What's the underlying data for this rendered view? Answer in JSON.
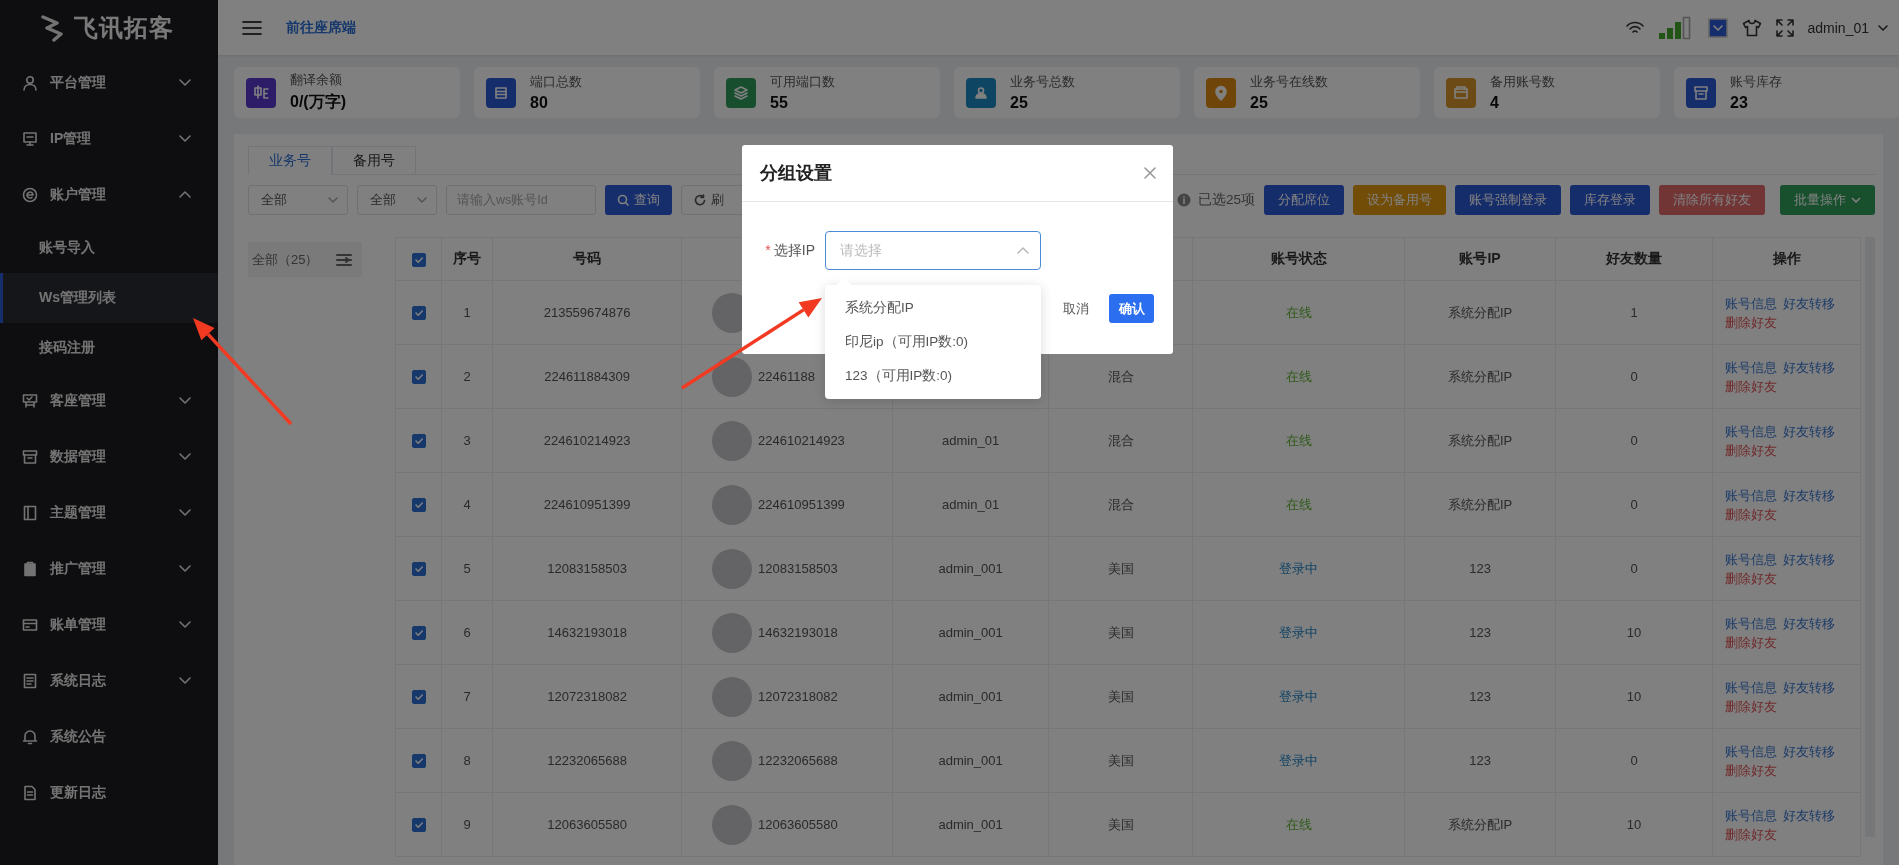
{
  "sidebar": {
    "logo": "飞讯拓客",
    "items": [
      {
        "label": "平台管理",
        "kind": "group",
        "expanded": false
      },
      {
        "label": "IP管理",
        "kind": "group",
        "expanded": false
      },
      {
        "label": "账户管理",
        "kind": "group",
        "expanded": true,
        "children": [
          {
            "label": "账号导入",
            "selected": false
          },
          {
            "label": "Ws管理列表",
            "selected": true
          },
          {
            "label": "接码注册",
            "selected": false
          }
        ]
      },
      {
        "label": "客座管理",
        "kind": "group",
        "expanded": false
      },
      {
        "label": "数据管理",
        "kind": "group",
        "expanded": false
      },
      {
        "label": "主题管理",
        "kind": "group",
        "expanded": false
      },
      {
        "label": "推广管理",
        "kind": "group",
        "expanded": false
      },
      {
        "label": "账单管理",
        "kind": "group",
        "expanded": false
      },
      {
        "label": "系统日志",
        "kind": "group",
        "expanded": false
      },
      {
        "label": "系统公告",
        "kind": "link"
      },
      {
        "label": "更新日志",
        "kind": "link"
      }
    ]
  },
  "header": {
    "link": "前往座席端",
    "user": "admin_01"
  },
  "stats": [
    {
      "label": "翻译余额",
      "value": "0/(万字)",
      "kind": "translate",
      "color": "#2d1d68"
    },
    {
      "label": "端口总数",
      "value": "80",
      "kind": "list",
      "color": "#162d6b"
    },
    {
      "label": "可用端口数",
      "value": "55",
      "kind": "layers",
      "color": "#174f2e"
    },
    {
      "label": "业务号总数",
      "value": "25",
      "kind": "person",
      "color": "#0d4563"
    },
    {
      "label": "业务号在线数",
      "value": "25",
      "kind": "pin",
      "color": "#704509"
    },
    {
      "label": "备用账号数",
      "value": "4",
      "kind": "box",
      "color": "#6c4b16"
    },
    {
      "label": "账号库存",
      "value": "23",
      "kind": "archive",
      "color": "#162d6b"
    }
  ],
  "tabs": [
    {
      "label": "业务号",
      "selected": true
    },
    {
      "label": "备用号",
      "selected": false
    }
  ],
  "filters": {
    "select_1": "全部",
    "select_2": "全部",
    "search": {
      "placeholder": "请输入ws账号Id"
    },
    "query_button": "查询",
    "refresh_button": "刷"
  },
  "selection_info": "已选25项",
  "actions": [
    {
      "label": "分配席位",
      "color": "#162d6b",
      "kind": "button"
    },
    {
      "label": "设为备用号",
      "color": "#724d08",
      "kind": "button"
    },
    {
      "label": "账号强制登录",
      "color": "#162d6b",
      "kind": "button"
    },
    {
      "label": "库存登录",
      "color": "#162d6b",
      "kind": "button"
    },
    {
      "label": "清除所有好友",
      "color": "#713535",
      "kind": "button"
    },
    {
      "label": "批量操作",
      "color": "#18502d",
      "kind": "dropdown"
    }
  ],
  "groups": {
    "label": "全部（25）"
  },
  "table": {
    "header_checked": true,
    "headers": {
      "index": "序号",
      "number": "号码",
      "status": "账号状态",
      "ip": "账号IP",
      "friends": "好友数量",
      "actions": "操作"
    },
    "rows": [
      {
        "checked": true,
        "index": "1",
        "number": "213559674876",
        "status": {
          "text": "在线",
          "kind": "online"
        },
        "ip": "系统分配IP",
        "friends": "1",
        "actions": [
          {
            "label": "账号信息",
            "kind": "link"
          },
          {
            "label": "好友转移",
            "kind": "link"
          },
          {
            "label": "删除好友",
            "kind": "danger"
          }
        ]
      },
      {
        "checked": true,
        "index": "2",
        "number": "224611884309",
        "nickname": "22461188",
        "column_6": "混合",
        "status": {
          "text": "在线",
          "kind": "online"
        },
        "ip": "系统分配IP",
        "friends": "0",
        "actions": [
          {
            "label": "账号信息",
            "kind": "link"
          },
          {
            "label": "好友转移",
            "kind": "link"
          },
          {
            "label": "删除好友",
            "kind": "danger"
          }
        ]
      },
      {
        "checked": true,
        "index": "3",
        "number": "224610214923",
        "nickname": "224610214923",
        "column_5": "admin_01",
        "column_6": "混合",
        "status": {
          "text": "在线",
          "kind": "online"
        },
        "ip": "系统分配IP",
        "friends": "0",
        "actions": [
          {
            "label": "账号信息",
            "kind": "link"
          },
          {
            "label": "好友转移",
            "kind": "link"
          },
          {
            "label": "删除好友",
            "kind": "danger"
          }
        ]
      },
      {
        "checked": true,
        "index": "4",
        "number": "224610951399",
        "nickname": "224610951399",
        "column_5": "admin_01",
        "column_6": "混合",
        "status": {
          "text": "在线",
          "kind": "online"
        },
        "ip": "系统分配IP",
        "friends": "0",
        "actions": [
          {
            "label": "账号信息",
            "kind": "link"
          },
          {
            "label": "好友转移",
            "kind": "link"
          },
          {
            "label": "删除好友",
            "kind": "danger"
          }
        ]
      },
      {
        "checked": true,
        "index": "5",
        "number": "12083158503",
        "nickname": "12083158503",
        "column_5": "admin_001",
        "column_6": "美国",
        "status": {
          "text": "登录中",
          "kind": "logging_in"
        },
        "ip": "123",
        "friends": "0",
        "actions": [
          {
            "label": "账号信息",
            "kind": "link"
          },
          {
            "label": "好友转移",
            "kind": "link"
          },
          {
            "label": "删除好友",
            "kind": "danger"
          }
        ]
      },
      {
        "checked": true,
        "index": "6",
        "number": "14632193018",
        "nickname": "14632193018",
        "column_5": "admin_001",
        "column_6": "美国",
        "status": {
          "text": "登录中",
          "kind": "logging_in"
        },
        "ip": "123",
        "friends": "10",
        "actions": [
          {
            "label": "账号信息",
            "kind": "link"
          },
          {
            "label": "好友转移",
            "kind": "link"
          },
          {
            "label": "删除好友",
            "kind": "danger"
          }
        ]
      },
      {
        "checked": true,
        "index": "7",
        "number": "12072318082",
        "nickname": "12072318082",
        "column_5": "admin_001",
        "column_6": "美国",
        "status": {
          "text": "登录中",
          "kind": "logging_in"
        },
        "ip": "123",
        "friends": "10",
        "actions": [
          {
            "label": "账号信息",
            "kind": "link"
          },
          {
            "label": "好友转移",
            "kind": "link"
          },
          {
            "label": "删除好友",
            "kind": "danger"
          }
        ]
      },
      {
        "checked": true,
        "index": "8",
        "number": "12232065688",
        "nickname": "12232065688",
        "column_5": "admin_001",
        "column_6": "美国",
        "status": {
          "text": "登录中",
          "kind": "logging_in"
        },
        "ip": "123",
        "friends": "0",
        "actions": [
          {
            "label": "账号信息",
            "kind": "link"
          },
          {
            "label": "好友转移",
            "kind": "link"
          },
          {
            "label": "删除好友",
            "kind": "danger"
          }
        ]
      },
      {
        "checked": true,
        "index": "9",
        "number": "12063605580",
        "nickname": "12063605580",
        "column_5": "admin_001",
        "column_6": "美国",
        "status": {
          "text": "在线",
          "kind": "online"
        },
        "ip": "系统分配IP",
        "friends": "10",
        "actions": [
          {
            "label": "账号信息",
            "kind": "link"
          },
          {
            "label": "好友转移",
            "kind": "link"
          },
          {
            "label": "删除好友",
            "kind": "danger"
          }
        ]
      }
    ]
  },
  "modal": {
    "title": "分组设置",
    "field": {
      "required_mark": "*",
      "label": "选择IP",
      "placeholder": "请选择",
      "expanded": true
    },
    "options": [
      {
        "label": "系统分配IP",
        "selected": false
      },
      {
        "label": "印尼ip（可用IP数:0)",
        "selected": false
      },
      {
        "label": "123（可用IP数:0)",
        "selected": false
      }
    ],
    "cancel": "取消",
    "confirm": "确认"
  },
  "annotations": [
    {
      "kind": "arrow"
    },
    {
      "kind": "arrow"
    }
  ]
}
